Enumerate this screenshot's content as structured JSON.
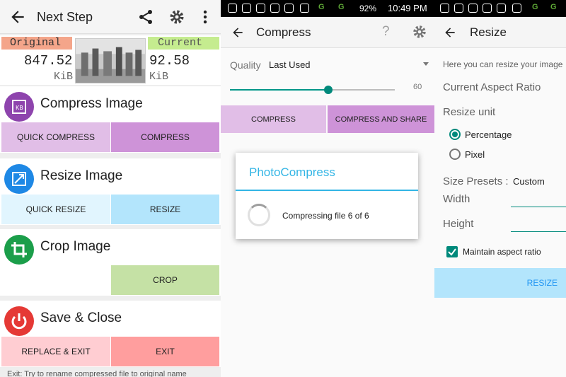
{
  "panel1": {
    "title": "Next Step",
    "original_label": "Original",
    "original_size": "847.52",
    "original_unit": "KiB",
    "current_label": "Current",
    "current_size": "92.58",
    "current_unit": "KiB",
    "cards": {
      "compress": {
        "title": "Compress Image",
        "left": "QUICK COMPRESS",
        "right": "COMPRESS"
      },
      "resize": {
        "title": "Resize Image",
        "left": "QUICK RESIZE",
        "right": "RESIZE"
      },
      "crop": {
        "title": "Crop Image",
        "right": "CROP"
      },
      "save": {
        "title": "Save & Close",
        "left": "REPLACE & EXIT",
        "right": "EXIT"
      }
    },
    "footer": "Exit: Try to rename compressed file to original name"
  },
  "panel2": {
    "status": {
      "battery": "92%",
      "time": "10:49 PM",
      "net1": "G",
      "net2": "G"
    },
    "title": "Compress",
    "help": "?",
    "quality_label": "Quality",
    "quality_value": "Last Used",
    "slider_value": "60",
    "slider_fraction": 0.6,
    "compress_button": "COMPRESS",
    "compress_share_button": "COMPRESS AND SHARE",
    "dialog_title": "PhotoCompress",
    "dialog_message": "Compressing file 6 of 6"
  },
  "panel3": {
    "status": {
      "net1": "G",
      "net2": "G"
    },
    "title": "Resize",
    "hint": "Here you can resize your image",
    "aspect_ratio_label": "Current Aspect Ratio",
    "unit_label": "Resize unit",
    "option_percentage": "Percentage",
    "option_pixel": "Pixel",
    "presets_label": "Size Presets :",
    "presets_value": "Custom",
    "width_label": "Width",
    "height_label": "Height",
    "maintain_label": "Maintain aspect ratio",
    "resize_button": "RESIZE"
  },
  "colors": {
    "accent_teal": "#00897b",
    "dialog_blue": "#33b5e5",
    "purple_light": "#e1bee7",
    "purple": "#ce93d8",
    "blue_light": "#b3e5fc",
    "green_light": "#c5e1a5",
    "red_light": "#ffcdd2",
    "red": "#ff9e9e"
  },
  "icons": [
    "back-arrow-icon",
    "share-icon",
    "gear-icon",
    "more-vert-icon",
    "kb-icon",
    "resize-icon",
    "crop-icon",
    "power-icon",
    "help-icon"
  ]
}
